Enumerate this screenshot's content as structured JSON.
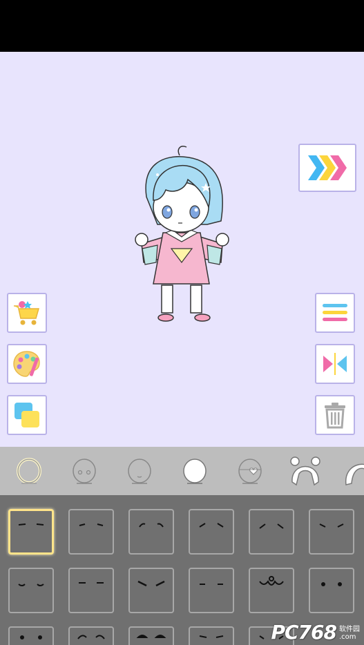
{
  "editor": {
    "background_color": "#e8e4fd",
    "buttons": [
      {
        "id": "next",
        "icon": "triple-chevron-icon"
      },
      {
        "id": "shop",
        "icon": "shopping-cart-icon"
      },
      {
        "id": "palette",
        "icon": "palette-icon"
      },
      {
        "id": "layers",
        "icon": "layers-icon"
      },
      {
        "id": "menu",
        "icon": "hamburger-menu-icon"
      },
      {
        "id": "flip",
        "icon": "flip-horizontal-icon"
      },
      {
        "id": "delete",
        "icon": "trash-icon"
      }
    ],
    "character": {
      "hair_color": "#a9dcf4",
      "dress_color": "#f6b7cf"
    }
  },
  "category_bar": {
    "items": [
      "face-glow-icon",
      "eyes-head-icon",
      "mouth-head-icon",
      "face-shape-icon",
      "heart-eyepatch-icon",
      "bear-ears-hair-icon",
      "hair-partial-icon"
    ],
    "selected_index": 0
  },
  "item_grid": {
    "selected_index": 0,
    "rows": 3,
    "columns": 6
  },
  "watermark": {
    "logo": "PC768",
    "tag_line1": "软件园",
    "tag_line2": ".com"
  }
}
